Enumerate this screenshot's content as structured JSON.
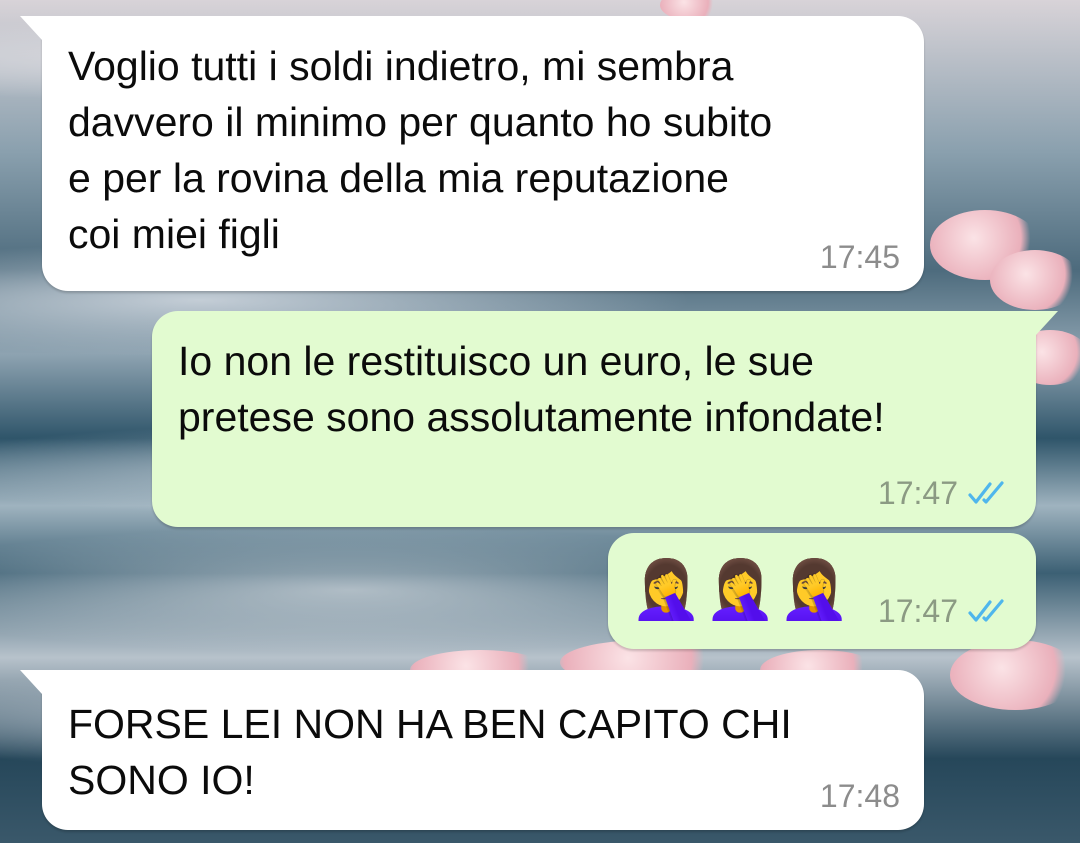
{
  "messages": [
    {
      "direction": "incoming",
      "text": "Voglio tutti i soldi indietro, mi sembra\ndavvero il minimo per quanto ho subito\ne per la rovina della mia reputazione\ncoi miei figli",
      "time": "17:45"
    },
    {
      "direction": "outgoing",
      "text": "Io non le restituisco un euro, le sue\npretese sono assolutamente infondate!",
      "time": "17:47",
      "status": "read",
      "status_icon": "double-check-icon"
    },
    {
      "direction": "outgoing",
      "text": "🤦‍♀️🤦‍♀️🤦‍♀️",
      "time": "17:47",
      "status": "read",
      "status_icon": "double-check-icon"
    },
    {
      "direction": "incoming",
      "text": "FORSE LEI NON HA BEN CAPITO CHI\nSONO IO!",
      "time": "17:48"
    }
  ],
  "colors": {
    "incoming_bubble": "#ffffff",
    "outgoing_bubble": "#e2fbd0",
    "read_tick": "#4fb6ec",
    "timestamp": "#8c8c8c"
  }
}
